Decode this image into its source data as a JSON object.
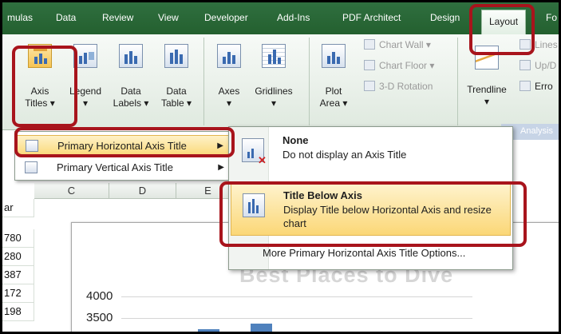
{
  "ribbon_tabs": [
    "mulas",
    "Data",
    "Review",
    "View",
    "Developer",
    "Add-Ins",
    "PDF Architect",
    "Design",
    "Layout",
    "Fo"
  ],
  "active_tab": "Layout",
  "ribbon": {
    "axis_titles": [
      "Axis",
      "Titles ▾"
    ],
    "legend": [
      "Legend",
      "▾"
    ],
    "data_labels": [
      "Data",
      "Labels ▾"
    ],
    "data_table": [
      "Data",
      "Table ▾"
    ],
    "axes": [
      "Axes",
      "▾"
    ],
    "gridlines": [
      "Gridlines",
      "▾"
    ],
    "plot_area": [
      "Plot",
      "Area ▾"
    ],
    "chart_wall": "Chart Wall ▾",
    "chart_floor": "Chart Floor ▾",
    "rotation": "3-D Rotation",
    "trendline": [
      "Trendline",
      "▾"
    ],
    "lines": "Lines",
    "updown": "Up/D",
    "error": "Erro",
    "analysis_group": "Analysis"
  },
  "axis_title_menu": {
    "primary_horizontal": "Primary Horizontal Axis Title",
    "primary_vertical": "Primary Vertical Axis Title"
  },
  "horizontal_submenu": {
    "none_title": "None",
    "none_desc": "Do not display an Axis Title",
    "below_title": "Title Below Axis",
    "below_desc": "Display Title below Horizontal Axis and resize chart",
    "more_options": "More Primary Horizontal Axis Title Options..."
  },
  "sheet": {
    "columns": [
      "C",
      "D",
      "E"
    ],
    "rows": [
      "ar",
      "780",
      "280",
      "387",
      "172",
      "198"
    ]
  },
  "chart_data": {
    "type": "bar",
    "title": "Best Places to Dive",
    "yticks": [
      "4000",
      "3500"
    ],
    "ylim": [
      0,
      4000
    ]
  },
  "colors": {
    "ribbon_tab_bg": "#2f6f3f",
    "highlight_red": "#a8141c",
    "menu_hover": "#fbd97a",
    "bar_blue": "#4f81bd"
  }
}
